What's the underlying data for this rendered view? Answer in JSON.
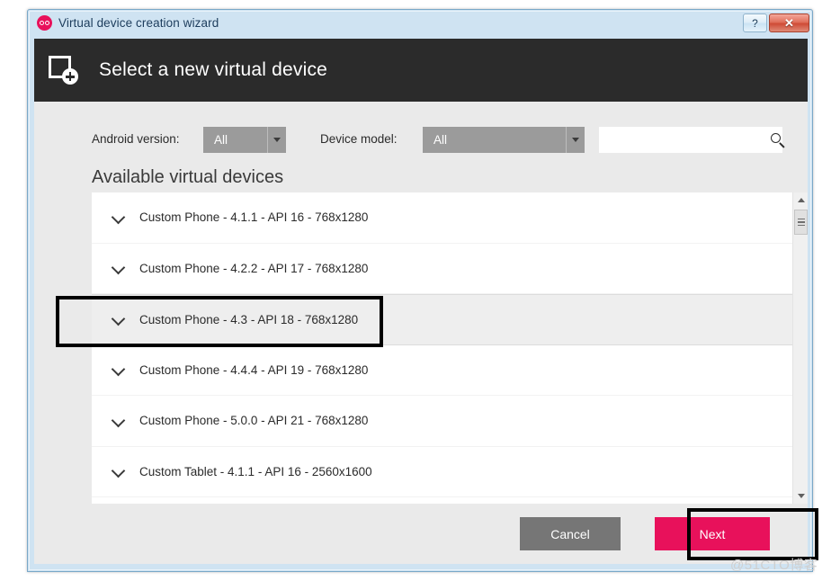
{
  "window": {
    "title": "Virtual device creation wizard",
    "app_icon": "goggles-icon",
    "caption_buttons": [
      {
        "name": "help-button",
        "label": "?"
      },
      {
        "name": "close-button",
        "label": "✕"
      }
    ]
  },
  "header": {
    "icon": "add-device-icon",
    "title": "Select a new virtual device"
  },
  "filters": {
    "android_version": {
      "label": "Android version:",
      "value": "All",
      "arrow_icon": "chevron-down-icon"
    },
    "device_model": {
      "label": "Device model:",
      "value": "All",
      "arrow_icon": "chevron-down-icon"
    },
    "search": {
      "value": "",
      "placeholder": "",
      "icon": "search-icon"
    }
  },
  "list": {
    "heading": "Available virtual devices",
    "expand_icon": "chevron-down-icon",
    "items": [
      {
        "label": "Custom Phone - 4.1.1 - API 16 - 768x1280",
        "selected": false
      },
      {
        "label": "Custom Phone - 4.2.2 - API 17 - 768x1280",
        "selected": false
      },
      {
        "label": "Custom Phone - 4.3 - API 18 - 768x1280",
        "selected": true
      },
      {
        "label": "Custom Phone - 4.4.4 - API 19 - 768x1280",
        "selected": false
      },
      {
        "label": "Custom Phone - 5.0.0 - API 21 - 768x1280",
        "selected": false
      },
      {
        "label": "Custom Tablet - 4.1.1 - API 16 - 2560x1600",
        "selected": false
      }
    ],
    "scrollbar": {
      "up_icon": "scroll-up-arrow-icon",
      "down_icon": "scroll-down-arrow-icon",
      "thumb": "scrollbar-thumb"
    }
  },
  "footer": {
    "cancel_label": "Cancel",
    "next_label": "Next"
  },
  "watermark": "@51CTO博客",
  "colors": {
    "accent": "#e8115b",
    "header_bg": "#2b2b2b",
    "body_bg": "#eaeaea",
    "cancel_bg": "#767676",
    "combo_bg": "#9b9b9b",
    "annotation": "#000000"
  }
}
